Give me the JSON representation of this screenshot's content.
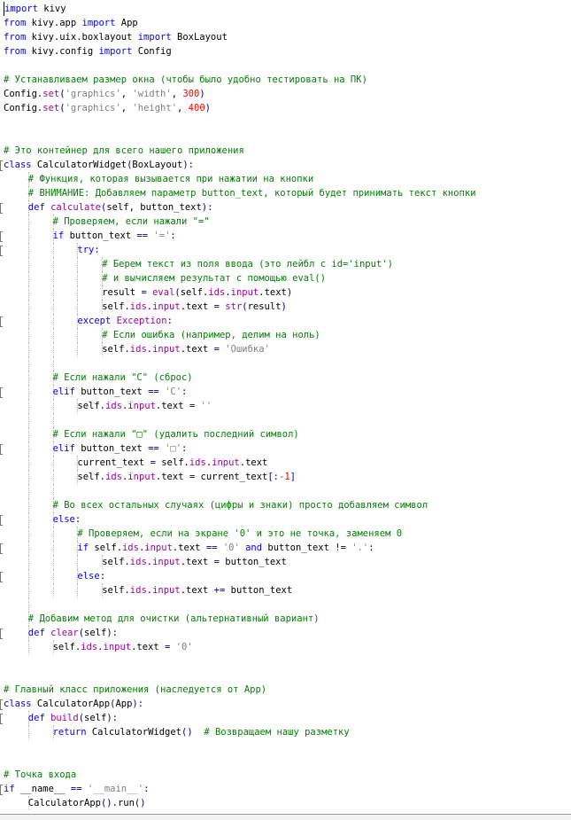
{
  "colors": {
    "keyword": "#0000ff",
    "builtin": "#a000a0",
    "comment": "#008000",
    "string": "#808080",
    "number": "#ff0000",
    "operator": "#000080",
    "text": "#000000",
    "background": "#ffffff"
  },
  "lines": [
    {
      "indent": 0,
      "tokens": [
        {
          "t": "import",
          "c": "kw"
        },
        {
          "t": " kivy",
          "c": ""
        }
      ]
    },
    {
      "indent": 0,
      "tokens": [
        {
          "t": "from",
          "c": "kw"
        },
        {
          "t": " kivy.app ",
          "c": ""
        },
        {
          "t": "import",
          "c": "kw"
        },
        {
          "t": " App",
          "c": ""
        }
      ]
    },
    {
      "indent": 0,
      "tokens": [
        {
          "t": "from",
          "c": "kw"
        },
        {
          "t": " kivy.uix.boxlayout ",
          "c": ""
        },
        {
          "t": "import",
          "c": "kw"
        },
        {
          "t": " BoxLayout",
          "c": ""
        }
      ]
    },
    {
      "indent": 0,
      "tokens": [
        {
          "t": "from",
          "c": "kw"
        },
        {
          "t": " kivy.config ",
          "c": ""
        },
        {
          "t": "import",
          "c": "kw"
        },
        {
          "t": " Config",
          "c": ""
        }
      ]
    },
    {
      "indent": 0,
      "tokens": []
    },
    {
      "indent": 0,
      "tokens": [
        {
          "t": "# Устанавливаем размер окна (чтобы было удобно тестировать на ПК)",
          "c": "cm"
        }
      ]
    },
    {
      "indent": 0,
      "tokens": [
        {
          "t": "Config.",
          "c": ""
        },
        {
          "t": "set",
          "c": "kwr"
        },
        {
          "t": "(",
          "c": "op"
        },
        {
          "t": "'graphics'",
          "c": "str"
        },
        {
          "t": ", ",
          "c": ""
        },
        {
          "t": "'width'",
          "c": "str"
        },
        {
          "t": ", ",
          "c": ""
        },
        {
          "t": "300",
          "c": "num"
        },
        {
          "t": ")",
          "c": "op"
        }
      ]
    },
    {
      "indent": 0,
      "tokens": [
        {
          "t": "Config.",
          "c": ""
        },
        {
          "t": "set",
          "c": "kwr"
        },
        {
          "t": "(",
          "c": "op"
        },
        {
          "t": "'graphics'",
          "c": "str"
        },
        {
          "t": ", ",
          "c": ""
        },
        {
          "t": "'height'",
          "c": "str"
        },
        {
          "t": ", ",
          "c": ""
        },
        {
          "t": "400",
          "c": "num"
        },
        {
          "t": ")",
          "c": "op"
        }
      ]
    },
    {
      "indent": 0,
      "tokens": []
    },
    {
      "indent": 0,
      "tokens": []
    },
    {
      "indent": 0,
      "tokens": [
        {
          "t": "# Это контейнер для всего нашего приложения",
          "c": "cm"
        }
      ]
    },
    {
      "indent": 0,
      "mark": true,
      "tokens": [
        {
          "t": "class",
          "c": "kw"
        },
        {
          "t": " CalculatorWidget",
          "c": ""
        },
        {
          "t": "(",
          "c": "op"
        },
        {
          "t": "BoxLayout",
          "c": ""
        },
        {
          "t": "):",
          "c": "op"
        }
      ]
    },
    {
      "indent": 1,
      "tokens": [
        {
          "t": "# Функция, которая вызывается при нажатии на кнопки",
          "c": "cm"
        }
      ]
    },
    {
      "indent": 1,
      "tokens": [
        {
          "t": "# ВНИМАНИЕ: Добавляем параметр button_text, который будет принимать текст кнопки",
          "c": "cm"
        }
      ]
    },
    {
      "indent": 1,
      "mark": true,
      "tokens": [
        {
          "t": "def",
          "c": "kw"
        },
        {
          "t": " ",
          "c": ""
        },
        {
          "t": "calculate",
          "c": "kwr"
        },
        {
          "t": "(",
          "c": "op"
        },
        {
          "t": "self, button_text",
          "c": ""
        },
        {
          "t": "):",
          "c": "op"
        }
      ]
    },
    {
      "indent": 2,
      "tokens": [
        {
          "t": "# Проверяем, если нажали \"=\"",
          "c": "cm"
        }
      ]
    },
    {
      "indent": 2,
      "mark": true,
      "tokens": [
        {
          "t": "if",
          "c": "kw"
        },
        {
          "t": " button_text ",
          "c": ""
        },
        {
          "t": "==",
          "c": "op"
        },
        {
          "t": " ",
          "c": ""
        },
        {
          "t": "'='",
          "c": "str"
        },
        {
          "t": ":",
          "c": "op"
        }
      ]
    },
    {
      "indent": 3,
      "mark": true,
      "tokens": [
        {
          "t": "try",
          "c": "kw"
        },
        {
          "t": ":",
          "c": "op"
        }
      ]
    },
    {
      "indent": 4,
      "tokens": [
        {
          "t": "# Берем текст из поля ввода (это лейбл с id='input')",
          "c": "cm"
        }
      ]
    },
    {
      "indent": 4,
      "tokens": [
        {
          "t": "# и вычисляем результат с помощью eval()",
          "c": "cm"
        }
      ]
    },
    {
      "indent": 4,
      "tokens": [
        {
          "t": "result ",
          "c": ""
        },
        {
          "t": "=",
          "c": "op"
        },
        {
          "t": " ",
          "c": ""
        },
        {
          "t": "eval",
          "c": "kwr"
        },
        {
          "t": "(",
          "c": "op"
        },
        {
          "t": "self.",
          "c": ""
        },
        {
          "t": "ids",
          "c": "kwr"
        },
        {
          "t": ".",
          "c": ""
        },
        {
          "t": "input",
          "c": "kwr"
        },
        {
          "t": ".text",
          "c": ""
        },
        {
          "t": ")",
          "c": "op"
        }
      ]
    },
    {
      "indent": 4,
      "tokens": [
        {
          "t": "self.",
          "c": ""
        },
        {
          "t": "ids",
          "c": "kwr"
        },
        {
          "t": ".",
          "c": ""
        },
        {
          "t": "input",
          "c": "kwr"
        },
        {
          "t": ".text ",
          "c": ""
        },
        {
          "t": "=",
          "c": "op"
        },
        {
          "t": " ",
          "c": ""
        },
        {
          "t": "str",
          "c": "kwr"
        },
        {
          "t": "(",
          "c": "op"
        },
        {
          "t": "result",
          "c": ""
        },
        {
          "t": ")",
          "c": "op"
        }
      ]
    },
    {
      "indent": 3,
      "mark": true,
      "tokens": [
        {
          "t": "except",
          "c": "kw"
        },
        {
          "t": " ",
          "c": ""
        },
        {
          "t": "Exception",
          "c": "kwr"
        },
        {
          "t": ":",
          "c": "op"
        }
      ]
    },
    {
      "indent": 4,
      "tokens": [
        {
          "t": "# Если ошибка (например, делим на ноль)",
          "c": "cm"
        }
      ]
    },
    {
      "indent": 4,
      "tokens": [
        {
          "t": "self.",
          "c": ""
        },
        {
          "t": "ids",
          "c": "kwr"
        },
        {
          "t": ".",
          "c": ""
        },
        {
          "t": "input",
          "c": "kwr"
        },
        {
          "t": ".text ",
          "c": ""
        },
        {
          "t": "=",
          "c": "op"
        },
        {
          "t": " ",
          "c": ""
        },
        {
          "t": "'Ошибка'",
          "c": "str"
        }
      ]
    },
    {
      "indent": 2,
      "tokens": []
    },
    {
      "indent": 2,
      "tokens": [
        {
          "t": "# Если нажали \"C\" (сброс)",
          "c": "cm"
        }
      ]
    },
    {
      "indent": 2,
      "mark": true,
      "tokens": [
        {
          "t": "elif",
          "c": "kw"
        },
        {
          "t": " button_text ",
          "c": ""
        },
        {
          "t": "==",
          "c": "op"
        },
        {
          "t": " ",
          "c": ""
        },
        {
          "t": "'C'",
          "c": "str"
        },
        {
          "t": ":",
          "c": "op"
        }
      ]
    },
    {
      "indent": 3,
      "tokens": [
        {
          "t": "self.",
          "c": ""
        },
        {
          "t": "ids",
          "c": "kwr"
        },
        {
          "t": ".",
          "c": ""
        },
        {
          "t": "input",
          "c": "kwr"
        },
        {
          "t": ".text ",
          "c": ""
        },
        {
          "t": "=",
          "c": "op"
        },
        {
          "t": " ",
          "c": ""
        },
        {
          "t": "''",
          "c": "str"
        }
      ]
    },
    {
      "indent": 2,
      "tokens": []
    },
    {
      "indent": 2,
      "tokens": [
        {
          "t": "# Если нажали \"□\" (удалить последний символ)",
          "c": "cm"
        }
      ]
    },
    {
      "indent": 2,
      "mark": true,
      "tokens": [
        {
          "t": "elif",
          "c": "kw"
        },
        {
          "t": " button_text ",
          "c": ""
        },
        {
          "t": "==",
          "c": "op"
        },
        {
          "t": " ",
          "c": ""
        },
        {
          "t": "'□'",
          "c": "str"
        },
        {
          "t": ":",
          "c": "op"
        }
      ]
    },
    {
      "indent": 3,
      "tokens": [
        {
          "t": "current_text ",
          "c": ""
        },
        {
          "t": "=",
          "c": "op"
        },
        {
          "t": " self.",
          "c": ""
        },
        {
          "t": "ids",
          "c": "kwr"
        },
        {
          "t": ".",
          "c": ""
        },
        {
          "t": "input",
          "c": "kwr"
        },
        {
          "t": ".text",
          "c": ""
        }
      ]
    },
    {
      "indent": 3,
      "tokens": [
        {
          "t": "self.",
          "c": ""
        },
        {
          "t": "ids",
          "c": "kwr"
        },
        {
          "t": ".",
          "c": ""
        },
        {
          "t": "input",
          "c": "kwr"
        },
        {
          "t": ".text ",
          "c": ""
        },
        {
          "t": "=",
          "c": "op"
        },
        {
          "t": " current_text",
          "c": ""
        },
        {
          "t": "[:",
          "c": "op"
        },
        {
          "t": "-1",
          "c": "num"
        },
        {
          "t": "]",
          "c": "op"
        }
      ]
    },
    {
      "indent": 2,
      "tokens": []
    },
    {
      "indent": 2,
      "tokens": [
        {
          "t": "# Во всех остальных случаях (цифры и знаки) просто добавляем символ",
          "c": "cm"
        }
      ]
    },
    {
      "indent": 2,
      "mark": true,
      "tokens": [
        {
          "t": "else",
          "c": "kw"
        },
        {
          "t": ":",
          "c": "op"
        }
      ]
    },
    {
      "indent": 3,
      "tokens": [
        {
          "t": "# Проверяем, если на экране '0' и это не точка, заменяем 0",
          "c": "cm"
        }
      ]
    },
    {
      "indent": 3,
      "mark": true,
      "tokens": [
        {
          "t": "if",
          "c": "kw"
        },
        {
          "t": " self.",
          "c": ""
        },
        {
          "t": "ids",
          "c": "kwr"
        },
        {
          "t": ".",
          "c": ""
        },
        {
          "t": "input",
          "c": "kwr"
        },
        {
          "t": ".text ",
          "c": ""
        },
        {
          "t": "==",
          "c": "op"
        },
        {
          "t": " ",
          "c": ""
        },
        {
          "t": "'0'",
          "c": "str"
        },
        {
          "t": " ",
          "c": ""
        },
        {
          "t": "and",
          "c": "kw"
        },
        {
          "t": " button_text ",
          "c": ""
        },
        {
          "t": "!=",
          "c": "op"
        },
        {
          "t": " ",
          "c": ""
        },
        {
          "t": "'.'",
          "c": "str"
        },
        {
          "t": ":",
          "c": "op"
        }
      ]
    },
    {
      "indent": 4,
      "tokens": [
        {
          "t": "self.",
          "c": ""
        },
        {
          "t": "ids",
          "c": "kwr"
        },
        {
          "t": ".",
          "c": ""
        },
        {
          "t": "input",
          "c": "kwr"
        },
        {
          "t": ".text ",
          "c": ""
        },
        {
          "t": "=",
          "c": "op"
        },
        {
          "t": " button_text",
          "c": ""
        }
      ]
    },
    {
      "indent": 3,
      "mark": true,
      "tokens": [
        {
          "t": "else",
          "c": "kw"
        },
        {
          "t": ":",
          "c": "op"
        }
      ]
    },
    {
      "indent": 4,
      "tokens": [
        {
          "t": "self.",
          "c": ""
        },
        {
          "t": "ids",
          "c": "kwr"
        },
        {
          "t": ".",
          "c": ""
        },
        {
          "t": "input",
          "c": "kwr"
        },
        {
          "t": ".text ",
          "c": ""
        },
        {
          "t": "+=",
          "c": "op"
        },
        {
          "t": " button_text",
          "c": ""
        }
      ]
    },
    {
      "indent": 1,
      "tokens": []
    },
    {
      "indent": 1,
      "tokens": [
        {
          "t": "# Добавим метод для очистки (альтернативный вариант)",
          "c": "cm"
        }
      ]
    },
    {
      "indent": 1,
      "mark": true,
      "tokens": [
        {
          "t": "def",
          "c": "kw"
        },
        {
          "t": " ",
          "c": ""
        },
        {
          "t": "clear",
          "c": "kwr"
        },
        {
          "t": "(",
          "c": "op"
        },
        {
          "t": "self",
          "c": ""
        },
        {
          "t": "):",
          "c": "op"
        }
      ]
    },
    {
      "indent": 2,
      "tokens": [
        {
          "t": "self.",
          "c": ""
        },
        {
          "t": "ids",
          "c": "kwr"
        },
        {
          "t": ".",
          "c": ""
        },
        {
          "t": "input",
          "c": "kwr"
        },
        {
          "t": ".text ",
          "c": ""
        },
        {
          "t": "=",
          "c": "op"
        },
        {
          "t": " ",
          "c": ""
        },
        {
          "t": "'0'",
          "c": "str"
        }
      ]
    },
    {
      "indent": 0,
      "tokens": []
    },
    {
      "indent": 0,
      "tokens": []
    },
    {
      "indent": 0,
      "tokens": [
        {
          "t": "# Главный класс приложения (наследуется от App)",
          "c": "cm"
        }
      ]
    },
    {
      "indent": 0,
      "mark": true,
      "tokens": [
        {
          "t": "class",
          "c": "kw"
        },
        {
          "t": " CalculatorApp",
          "c": ""
        },
        {
          "t": "(",
          "c": "op"
        },
        {
          "t": "App",
          "c": ""
        },
        {
          "t": "):",
          "c": "op"
        }
      ]
    },
    {
      "indent": 1,
      "mark": true,
      "tokens": [
        {
          "t": "def",
          "c": "kw"
        },
        {
          "t": " ",
          "c": ""
        },
        {
          "t": "build",
          "c": "kwr"
        },
        {
          "t": "(",
          "c": "op"
        },
        {
          "t": "self",
          "c": ""
        },
        {
          "t": "):",
          "c": "op"
        }
      ]
    },
    {
      "indent": 2,
      "tokens": [
        {
          "t": "return",
          "c": "kw"
        },
        {
          "t": " CalculatorWidget",
          "c": ""
        },
        {
          "t": "()",
          "c": "op"
        },
        {
          "t": "  ",
          "c": ""
        },
        {
          "t": "# Возвращаем нашу разметку",
          "c": "cm"
        }
      ]
    },
    {
      "indent": 0,
      "tokens": []
    },
    {
      "indent": 0,
      "tokens": []
    },
    {
      "indent": 0,
      "tokens": [
        {
          "t": "# Точка входа",
          "c": "cm"
        }
      ]
    },
    {
      "indent": 0,
      "mark": true,
      "tokens": [
        {
          "t": "if",
          "c": "kw"
        },
        {
          "t": " __name__ ",
          "c": ""
        },
        {
          "t": "==",
          "c": "op"
        },
        {
          "t": " ",
          "c": ""
        },
        {
          "t": "'__main__'",
          "c": "str"
        },
        {
          "t": ":",
          "c": "op"
        }
      ]
    },
    {
      "indent": 1,
      "tokens": [
        {
          "t": "CalculatorApp",
          "c": ""
        },
        {
          "t": "().",
          "c": "op"
        },
        {
          "t": "run",
          "c": ""
        },
        {
          "t": "()",
          "c": "op"
        }
      ]
    }
  ]
}
